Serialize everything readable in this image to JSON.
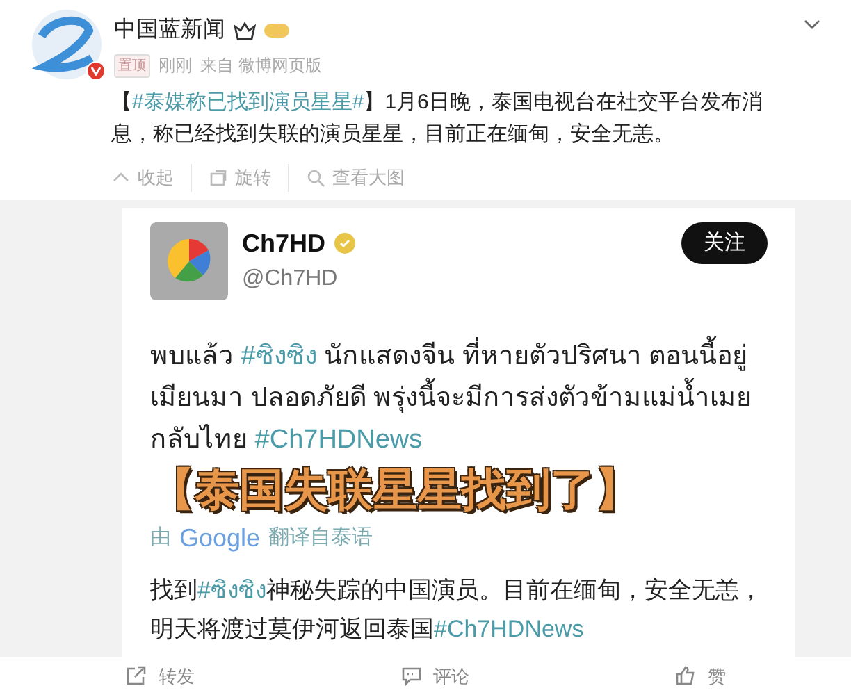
{
  "post": {
    "author": "中国蓝新闻",
    "tag": "置顶",
    "time": "刚刚",
    "source": "来自 微博网页版",
    "text": [
      {
        "kind": "text",
        "text": "【"
      },
      {
        "kind": "hashtag",
        "text": "#泰媒称已找到演员星星#"
      },
      {
        "kind": "text",
        "text": "】1月6日晚，泰国电视台在社交平台发布消息，称已经找到失联的演员星星，目前正在缅甸，安全无恙。"
      }
    ],
    "actions": [
      {
        "kind": "collapse",
        "label": "收起"
      },
      {
        "kind": "rotate",
        "label": "旋转"
      },
      {
        "kind": "view",
        "label": "查看大图"
      }
    ]
  },
  "embedded": {
    "name": "Ch7HD",
    "handle": "@Ch7HD",
    "follow": "关注",
    "thai": [
      {
        "kind": "text",
        "text": "พบแล้ว "
      },
      {
        "kind": "hashtag",
        "text": "#ซิงซิง"
      },
      {
        "kind": "text",
        "text": " นักแสดงจีน ที่หายตัวปริศนา ตอนนี้อยู่เมียนมา ปลอดภัยดี พรุ่งนี้จะมีการส่งตัวข้ามแม่น้ำเมยกลับไทย "
      },
      {
        "kind": "hashtag",
        "text": "#Ch7HDNews"
      }
    ],
    "caption": "【泰国失联星星找到了】",
    "translated_by": "由",
    "translator": "Google",
    "translated_from": "翻译自泰语",
    "translation": [
      {
        "kind": "text",
        "text": "找到"
      },
      {
        "kind": "hashtag",
        "text": "#ซิงซิง"
      },
      {
        "kind": "text",
        "text": "神秘失踪的中国演员。目前在缅甸，安全无恙，明天将渡过莫伊河返回泰国"
      },
      {
        "kind": "hashtag",
        "text": "#Ch7HDNews"
      }
    ]
  },
  "footer": [
    {
      "kind": "repost",
      "label": "转发"
    },
    {
      "kind": "comment",
      "label": "评论"
    },
    {
      "kind": "like",
      "label": "赞"
    }
  ]
}
